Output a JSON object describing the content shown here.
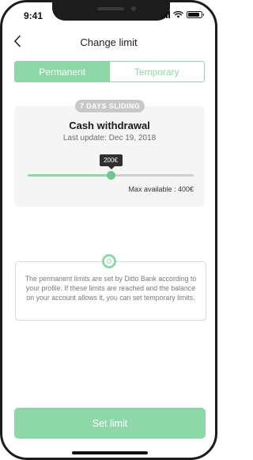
{
  "status_bar": {
    "time": "9:41"
  },
  "header": {
    "title": "Change limit"
  },
  "tabs": [
    {
      "label": "Permanent",
      "active": true
    },
    {
      "label": "Temporary",
      "active": false
    }
  ],
  "limit_card": {
    "badge": "7 DAYS SLIDING",
    "title": "Cash withdrawal",
    "last_update": "Last update: Dec 19, 2018",
    "slider_value_label": "200€",
    "slider_fraction": 0.5,
    "max_available": "Max available : 400€"
  },
  "info": {
    "text": "The permanent limits are set by Ditto Bank according to your profile. If these limits are reached and the balance on your account allows it, you can set temporary limits."
  },
  "cta": {
    "label": "Set limit"
  },
  "colors": {
    "accent": "#8dd7a9",
    "accent_dark": "#6fc693",
    "badge": "#c8c8c8",
    "tooltip": "#2f2f2f"
  },
  "icons": [
    "back-chevron-icon",
    "signal-icon",
    "wifi-icon",
    "battery-icon",
    "info-ring-icon"
  ]
}
